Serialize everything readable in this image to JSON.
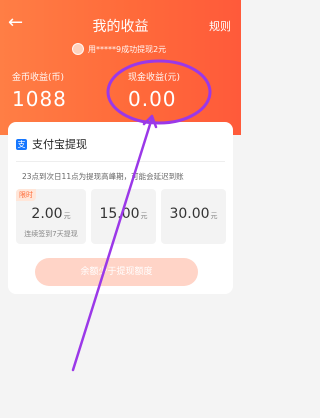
{
  "header": {
    "back_icon": "←",
    "title": "我的收益",
    "rules_label": "规则",
    "ticker_text": "用*****9成功提现2元"
  },
  "balances": {
    "coin_label": "金币收益(币)",
    "coin_value": "1088",
    "cash_label": "现金收益(元)",
    "cash_value": "0.00"
  },
  "withdraw": {
    "method_label": "支付宝提现",
    "notice": "23点到次日11点为提现高峰期，可能会延迟到账",
    "options": [
      {
        "tag": "限时",
        "amount": "2.00",
        "unit": "元",
        "sub": "连续签到7天提现"
      },
      {
        "amount": "15.00",
        "unit": "元"
      },
      {
        "amount": "30.00",
        "unit": "元"
      }
    ],
    "cta_label": "余额少于提现额度"
  },
  "colors": {
    "brand": "#ff6a3a",
    "annotation": "#9b38e8",
    "alipay": "#1677ff"
  }
}
